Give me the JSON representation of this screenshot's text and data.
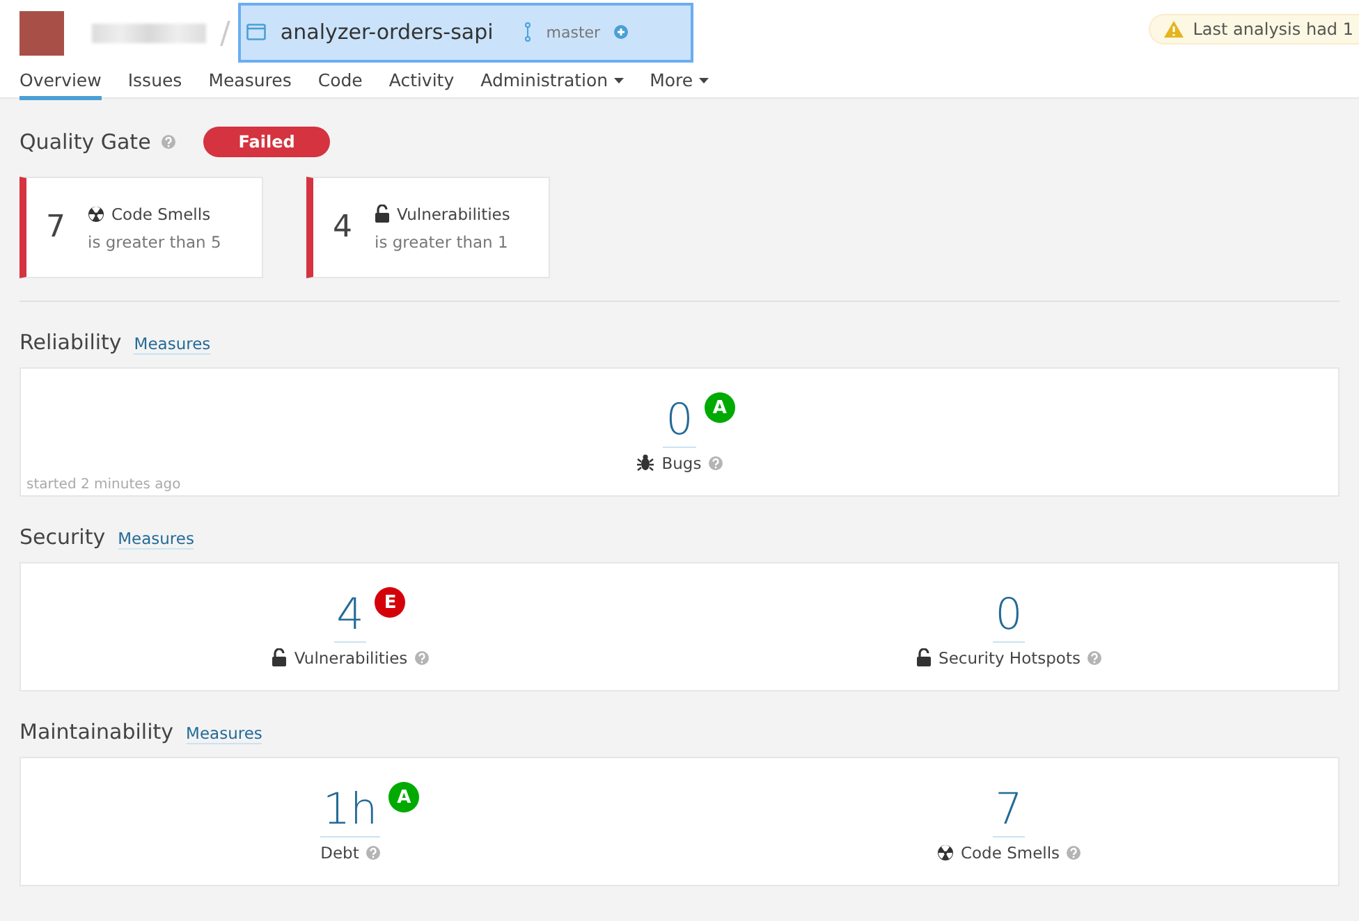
{
  "header": {
    "separator": "/",
    "project": "analyzer-orders-sapi",
    "branch": "master",
    "warning": "Last analysis had 1"
  },
  "tabs": [
    {
      "label": "Overview",
      "selected": true,
      "dropdown": false
    },
    {
      "label": "Issues",
      "selected": false,
      "dropdown": false
    },
    {
      "label": "Measures",
      "selected": false,
      "dropdown": false
    },
    {
      "label": "Code",
      "selected": false,
      "dropdown": false
    },
    {
      "label": "Activity",
      "selected": false,
      "dropdown": false
    },
    {
      "label": "Administration",
      "selected": false,
      "dropdown": true
    },
    {
      "label": "More",
      "selected": false,
      "dropdown": true
    }
  ],
  "quality_gate": {
    "title": "Quality Gate",
    "status": "Failed",
    "conditions": [
      {
        "value": "7",
        "kind": "smell",
        "metric": "Code Smells",
        "condition": "is greater than 5"
      },
      {
        "value": "4",
        "kind": "lock",
        "metric": "Vulnerabilities",
        "condition": "is greater than 1"
      }
    ]
  },
  "sections": [
    {
      "title": "Reliability",
      "link": "Measures",
      "note": "started 2 minutes ago",
      "measures": [
        {
          "value": "0",
          "kind": "bug",
          "label": "Bugs",
          "rating": "A",
          "color": "#00aa00"
        }
      ]
    },
    {
      "title": "Security",
      "link": "Measures",
      "measures": [
        {
          "value": "4",
          "kind": "lock",
          "label": "Vulnerabilities",
          "rating": "E",
          "color": "#d4000a"
        },
        {
          "value": "0",
          "kind": "hotspot",
          "label": "Security Hotspots"
        }
      ]
    },
    {
      "title": "Maintainability",
      "link": "Measures",
      "measures": [
        {
          "value": "1h",
          "kind": "none",
          "label": "Debt",
          "rating": "A",
          "color": "#00aa00"
        },
        {
          "value": "7",
          "kind": "smell",
          "label": "Code Smells"
        }
      ]
    }
  ]
}
